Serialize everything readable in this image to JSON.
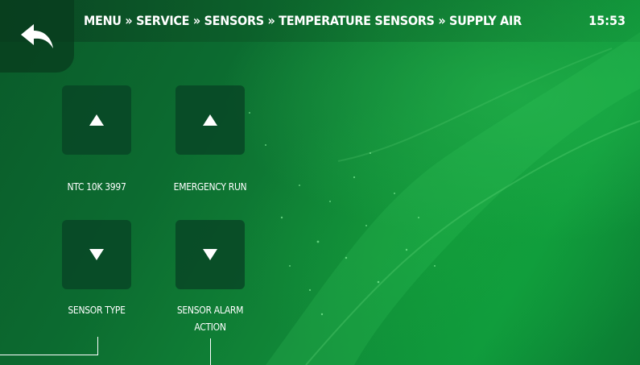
{
  "header": {
    "breadcrumb": "MENU » SERVICE » SENSORS » TEMPERATURE SENSORS » SUPPLY AIR",
    "time": "15:53",
    "back_icon": "back-arrow-icon"
  },
  "controls": {
    "sensor_type": {
      "value": "NTC 10K 3997",
      "label": "SENSOR TYPE"
    },
    "sensor_alarm_action": {
      "value": "EMERGENCY RUN",
      "label_line1": "SENSOR ALARM",
      "label_line2": "ACTION"
    }
  },
  "colors": {
    "background_dark": "#0a5a2a",
    "background_bright": "#0f9a3c",
    "tile": "#0b4a26",
    "text": "#ffffff"
  }
}
